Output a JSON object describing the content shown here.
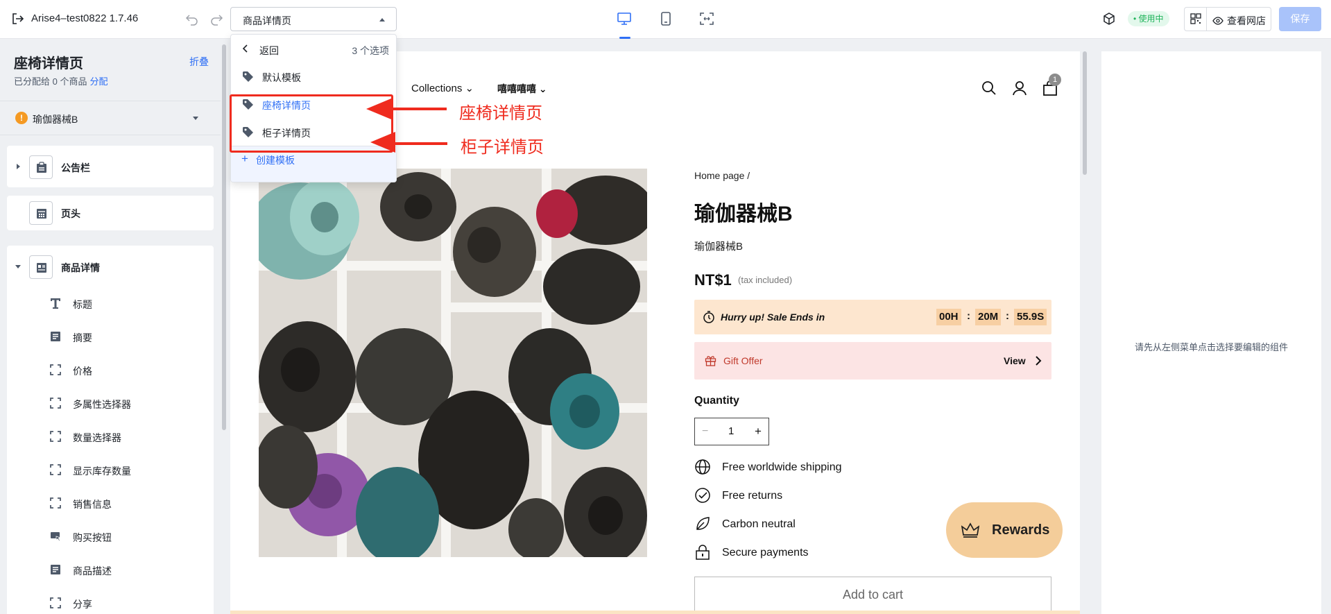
{
  "topbar": {
    "app_title": "Arise4–test0822 1.7.46",
    "template_select": "商品详情页",
    "status_badge": "• 使用中",
    "view_store": "查看网店",
    "save": "保存",
    "accent_color": "#2f6ff5"
  },
  "sidebar": {
    "title": "座椅详情页",
    "fold": "折叠",
    "assigned_text": "已分配给 0 个商品",
    "assign_link": "分配",
    "product_warning": "!",
    "product": "瑜伽器械B",
    "sections": {
      "announcement": "公告栏",
      "header": "页头",
      "product_detail": "商品详情"
    },
    "blocks": [
      {
        "label": "标题",
        "icon": "title-icon"
      },
      {
        "label": "摘要",
        "icon": "text-lines-icon"
      },
      {
        "label": "价格",
        "icon": "frame-icon"
      },
      {
        "label": "多属性选择器",
        "icon": "frame-icon"
      },
      {
        "label": "数量选择器",
        "icon": "frame-icon"
      },
      {
        "label": "显示库存数量",
        "icon": "frame-icon"
      },
      {
        "label": "销售信息",
        "icon": "frame-icon"
      },
      {
        "label": "购买按钮",
        "icon": "cursor-button-icon"
      },
      {
        "label": "商品描述",
        "icon": "text-lines-icon"
      },
      {
        "label": "分享",
        "icon": "frame-icon"
      }
    ]
  },
  "dropdown": {
    "back": "返回",
    "count": "3 个选项",
    "items": [
      {
        "label": "默认模板"
      },
      {
        "label": "座椅详情页"
      },
      {
        "label": "柜子详情页"
      }
    ],
    "create": "创建模板"
  },
  "annotations": {
    "label_1": "座椅详情页",
    "label_2": "柜子详情页",
    "color": "#ef2b1e"
  },
  "preview": {
    "nav": {
      "collections": "Collections",
      "menu_2": "嘻嘻嘻嘻"
    },
    "cart_count": "1",
    "breadcrumb": "Home page /",
    "product_title": "瑜伽器械B",
    "product_subtitle": "瑜伽器械B",
    "price": "NT$1",
    "tax_note": "(tax included)",
    "sale": {
      "text": "Hurry up! Sale Ends in",
      "hours": "00H",
      "minutes": "20M",
      "seconds": "55.9S",
      "separator": ":"
    },
    "gift": {
      "text": "Gift Offer",
      "view": "View"
    },
    "quantity_label": "Quantity",
    "quantity_value": "1",
    "quantity_minus": "−",
    "quantity_plus": "+",
    "features": [
      {
        "label": "Free worldwide shipping",
        "icon": "globe-icon"
      },
      {
        "label": "Free returns",
        "icon": "check-circle-icon"
      },
      {
        "label": "Carbon neutral",
        "icon": "leaf-icon"
      },
      {
        "label": "Secure payments",
        "icon": "lock-icon"
      }
    ],
    "rewards": "Rewards",
    "add_to_cart": "Add to cart"
  },
  "right_panel": {
    "hint": "请先从左侧菜单点击选择要编辑的组件"
  }
}
